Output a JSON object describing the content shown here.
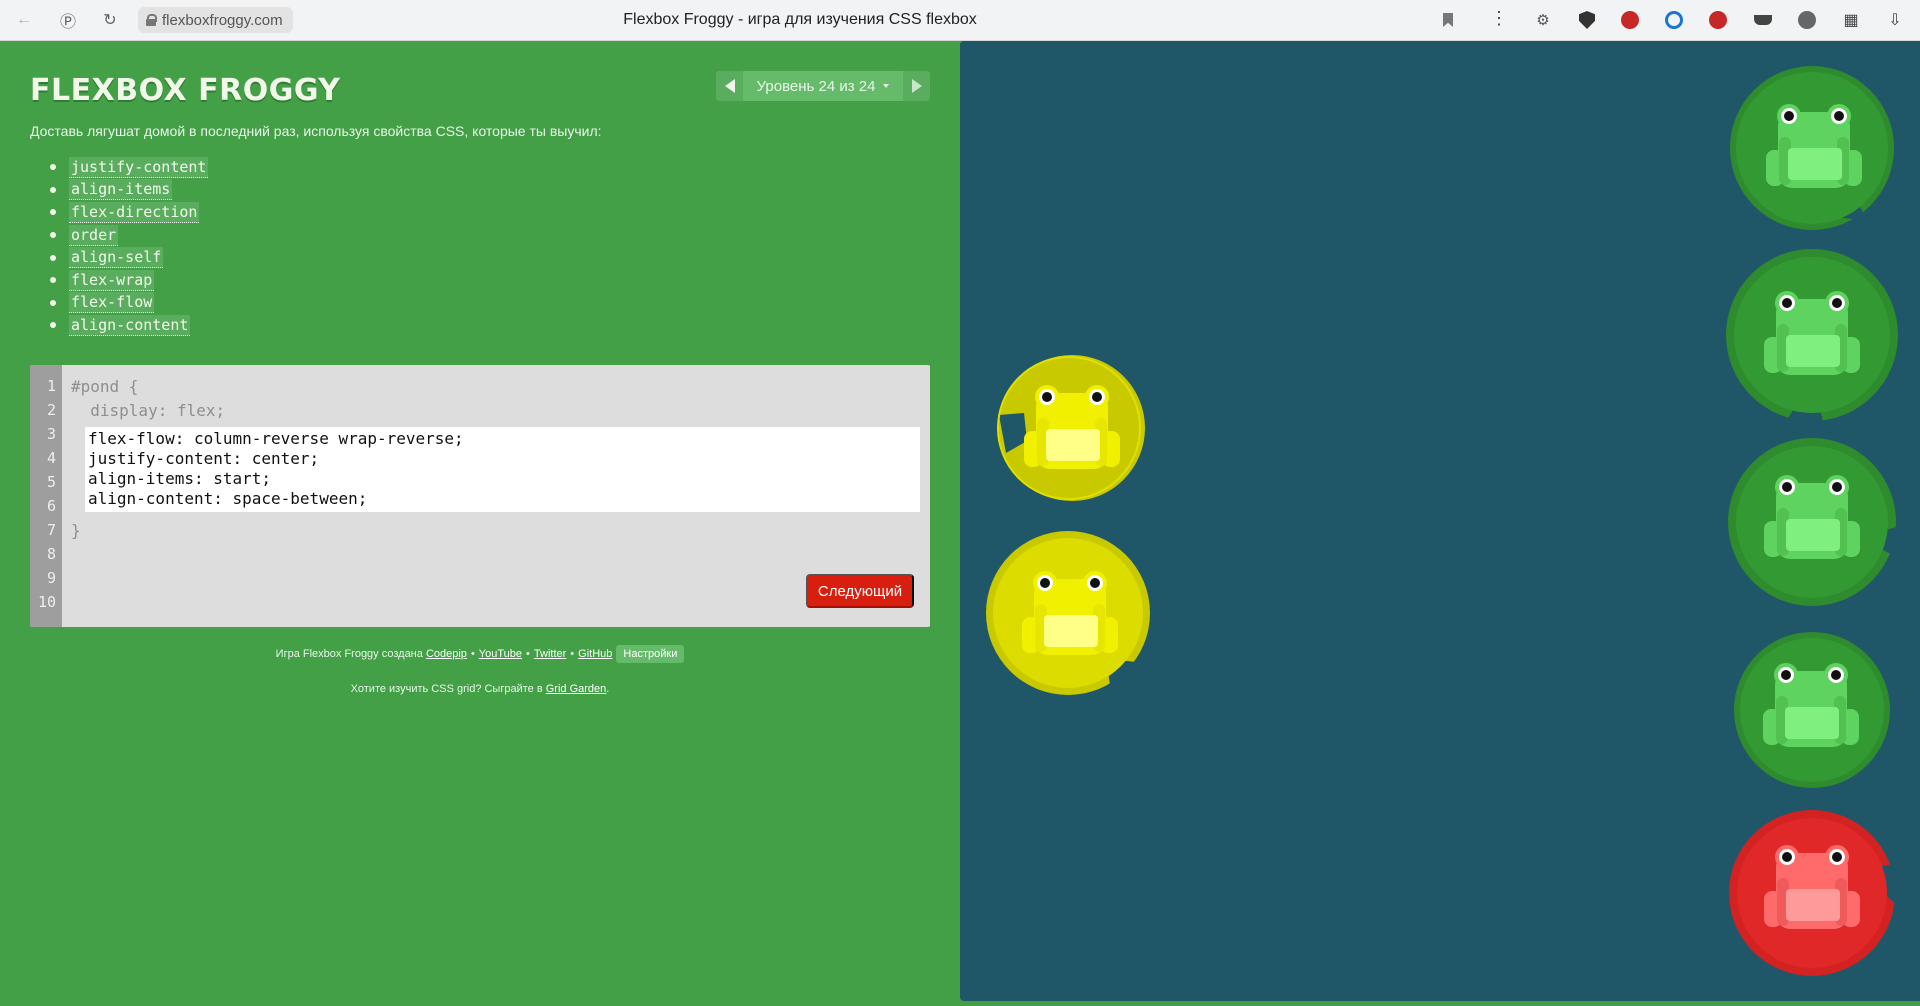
{
  "browser": {
    "url": "flexboxfroggy.com",
    "title": "Flexbox Froggy - игра для изучения CSS flexbox"
  },
  "app": {
    "logo": "FLEXBOX FROGGY",
    "level_label": "Уровень 24 из 24",
    "instructions": "Доставь лягушат домой в последний раз, используя свойства CSS, которые ты выучил:",
    "properties": [
      "justify-content",
      "align-items",
      "flex-direction",
      "order",
      "align-self",
      "flex-wrap",
      "flex-flow",
      "align-content"
    ]
  },
  "editor": {
    "line_numbers": [
      "1",
      "2",
      "3",
      "4",
      "5",
      "6",
      "7",
      "8",
      "9",
      "10"
    ],
    "before_lines": [
      "#pond {",
      "  display: flex;"
    ],
    "user_lines": [
      "flex-flow: column-reverse wrap-reverse;",
      "justify-content: center;",
      "align-items: start;",
      "align-content: space-between;"
    ],
    "after_lines": [
      "}"
    ],
    "next_label": "Следующий"
  },
  "footer": {
    "credit_prefix": "Игра Flexbox Froggy создана",
    "links": [
      "Codepip",
      "YouTube",
      "Twitter",
      "GitHub"
    ],
    "bullet": "•",
    "settings_label": "Настройки",
    "grid_text": "Хотите изучить CSS grid? Сыграйте в",
    "grid_link": "Grid Garden",
    "grid_end": "."
  },
  "pond": {
    "colors": {
      "background": "#1f5768",
      "yellow_pad": "#c9c900",
      "yellow_frog": "#f0f000",
      "green_pad": "#2e8b2e",
      "green_frog": "#5fd35f",
      "red_pad": "#d32222",
      "red_frog": "#ff6b6b"
    },
    "lilypads": [
      "yellow",
      "yellow",
      "green",
      "green",
      "green",
      "green",
      "red"
    ],
    "frogs": [
      "yellow",
      "yellow",
      "green",
      "green",
      "green",
      "green",
      "red"
    ]
  }
}
